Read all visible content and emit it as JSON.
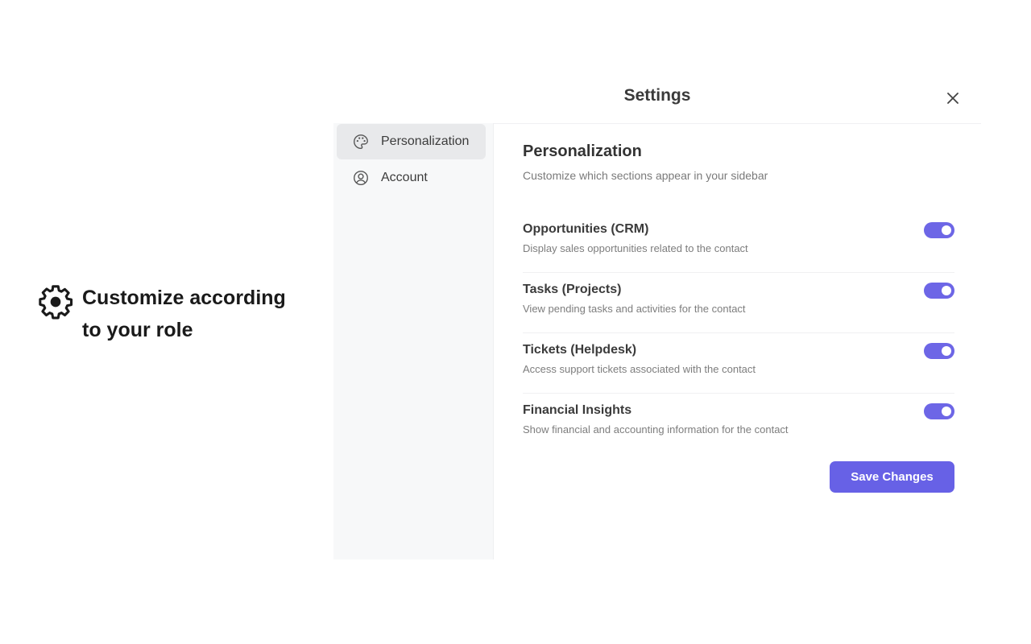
{
  "promo": {
    "icon": "gear-icon",
    "text": "Customize according to your role"
  },
  "dialog": {
    "title": "Settings",
    "close_icon": "close-icon"
  },
  "sidebar": {
    "items": [
      {
        "label": "Personalization",
        "icon": "palette-icon",
        "active": true
      },
      {
        "label": "Account",
        "icon": "user-circle-icon",
        "active": false
      }
    ]
  },
  "personalization": {
    "title": "Personalization",
    "subtitle": "Customize which sections appear in your sidebar",
    "options": [
      {
        "title": "Opportunities (CRM)",
        "description": "Display sales opportunities related to the contact",
        "enabled": true
      },
      {
        "title": "Tasks (Projects)",
        "description": "View pending tasks and activities for the contact",
        "enabled": true
      },
      {
        "title": "Tickets (Helpdesk)",
        "description": "Access support tickets associated with the contact",
        "enabled": true
      },
      {
        "title": "Financial Insights",
        "description": "Show financial and accounting information for the contact",
        "enabled": true
      }
    ],
    "save_label": "Save Changes"
  },
  "colors": {
    "accent": "#6761e6",
    "sidebar_bg": "#f7f8f9",
    "active_item_bg": "#e8e9eb"
  }
}
